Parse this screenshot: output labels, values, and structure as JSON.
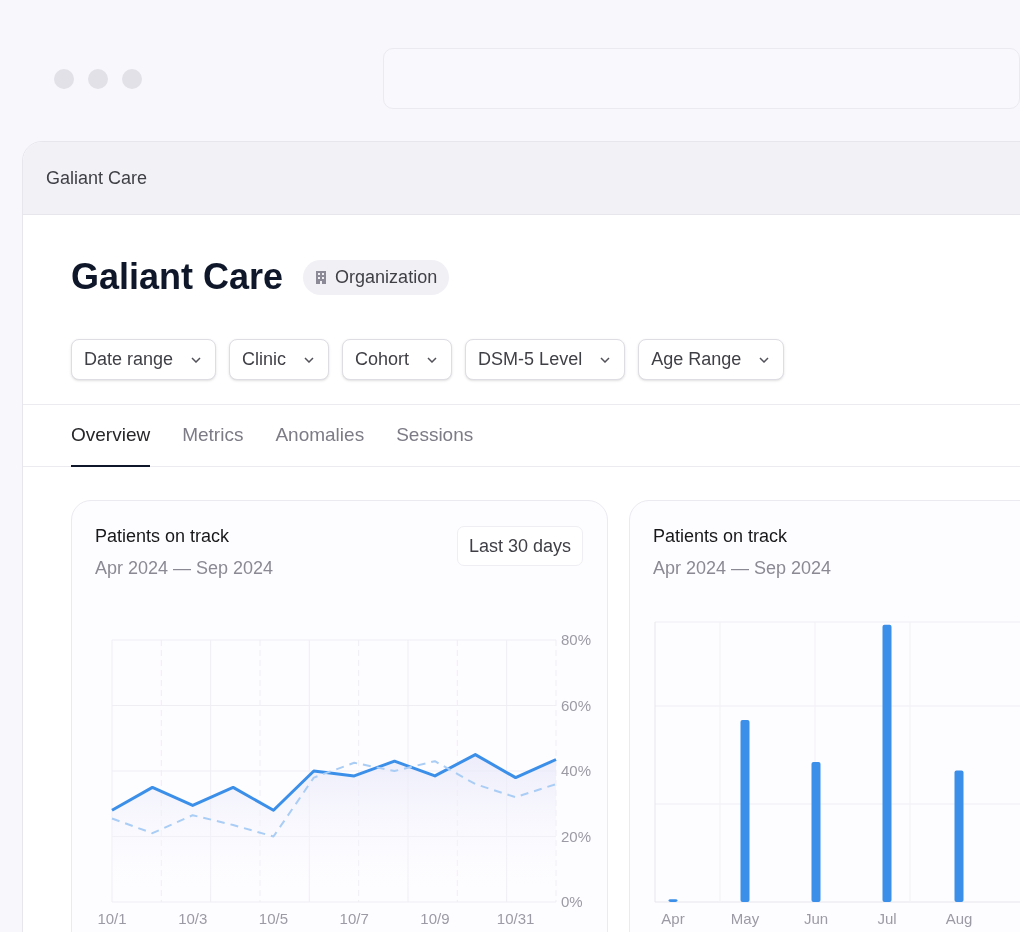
{
  "window": {
    "title": "Galiant Care"
  },
  "header": {
    "title": "Galiant Care",
    "badge": "Organization"
  },
  "filters": [
    {
      "label": "Date range"
    },
    {
      "label": "Clinic"
    },
    {
      "label": "Cohort"
    },
    {
      "label": "DSM-5 Level"
    },
    {
      "label": "Age Range"
    }
  ],
  "tabs": [
    {
      "label": "Overview",
      "selected": true
    },
    {
      "label": "Metrics",
      "selected": false
    },
    {
      "label": "Anomalies",
      "selected": false
    },
    {
      "label": "Sessions",
      "selected": false
    }
  ],
  "cards": [
    {
      "kind": "line",
      "title": "Patients on track",
      "subtitle": "Apr 2024 — Sep 2024",
      "range_button": "Last 30 days",
      "chart_data": {
        "type": "line",
        "grid": true,
        "categories": [
          "10/1",
          null,
          "10/3",
          null,
          "10/5",
          null,
          "10/7",
          null,
          "10/9",
          null,
          "10/31",
          null
        ],
        "ylim": [
          0,
          80
        ],
        "yticks": [
          {
            "value": 0,
            "label": "0%"
          },
          {
            "value": 20,
            "label": "20%"
          },
          {
            "value": 40,
            "label": "40%"
          },
          {
            "value": 60,
            "label": "60%"
          },
          {
            "value": 80,
            "label": "80%"
          }
        ],
        "series": [
          {
            "line_style": "solid",
            "color": "#3b8fe8",
            "values": [
              28,
              35,
              29.5,
              35,
              28,
              40,
              38.5,
              43,
              38.5,
              45,
              38,
              43.5
            ]
          },
          {
            "line_style": "dashed",
            "color": "#a9cdf5",
            "values": [
              25.5,
              21,
              26.5,
              23.5,
              20,
              38,
              42.5,
              40,
              43,
              36,
              32,
              36
            ]
          }
        ]
      }
    },
    {
      "kind": "bar",
      "title": "Patients on track",
      "subtitle": "Apr 2024 — Sep 2024",
      "x_labels": [
        "Apr",
        "May",
        "Jun",
        "Jul",
        "Aug"
      ]
    }
  ]
}
